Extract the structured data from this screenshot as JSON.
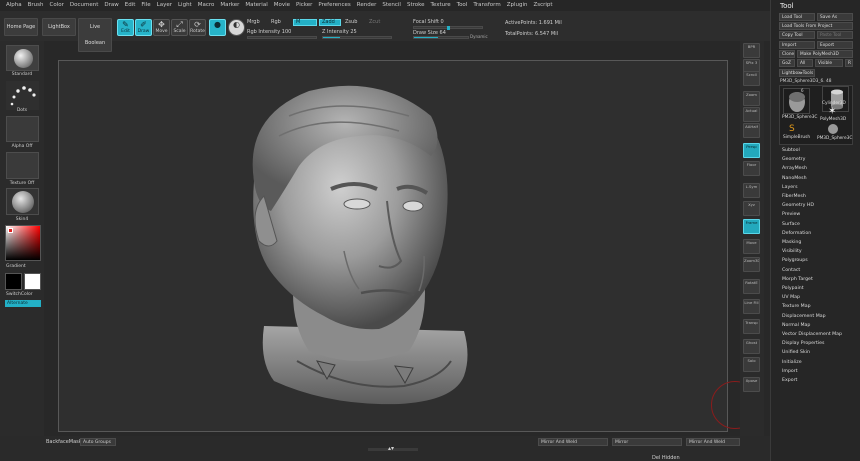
{
  "menu": [
    "Alpha",
    "Brush",
    "Color",
    "Document",
    "Draw",
    "Edit",
    "File",
    "Layer",
    "Light",
    "Macro",
    "Marker",
    "Material",
    "Movie",
    "Picker",
    "Preferences",
    "Render",
    "Stencil",
    "Stroke",
    "Texture",
    "Tool",
    "Transform",
    "Zplugin",
    "Zscript"
  ],
  "topbar": {
    "home_page": "Home Page",
    "lightbox": "LightBox",
    "live_boolean": "Live Boolean",
    "edit": "Edit",
    "draw": "Draw",
    "move": "Move",
    "scale": "Scale",
    "rotate": "Rotate",
    "mrgb": "Mrgb",
    "rgb": "Rgb",
    "m": "M",
    "zadd": "Zadd",
    "zsub": "Zsub",
    "zcut": "Zcut",
    "rgb_intensity_label": "Rgb Intensity",
    "rgb_intensity_value": "100",
    "z_intensity_label": "Z Intensity",
    "z_intensity_value": "25",
    "focal_shift_label": "Focal Shift",
    "focal_shift_value": "0",
    "draw_size_label": "Draw Size",
    "draw_size_value": "64",
    "dynamic": "Dynamic",
    "active_points": "ActivePoints: 1.691 Mil",
    "total_points": "TotalPoints: 6.547 Mil"
  },
  "left": {
    "standard": "Standard",
    "dots": "Dots",
    "alpha_off": "Alpha Off",
    "texture_off": "Texture Off",
    "skin": "Skin4",
    "gradient": "Gradient",
    "switch_color": "SwitchColor",
    "alternate": "Alternate"
  },
  "bottom": {
    "backface_mask": "BackfaceMask",
    "auto_groups": "Auto Groups",
    "mirror_and_weld_1": "Mirror And Weld",
    "mirror": "Mirror",
    "mirror_and_weld_2": "Mirror And Weld",
    "del_hidden": "Del Hidden"
  },
  "shelf": [
    "BPR",
    "SPix 3",
    "Scroll",
    "Zoom",
    "Actual",
    "AAHalf",
    "Persp",
    "Floor",
    "L.Sym",
    "Xyz",
    "Frame",
    "Move",
    "Zoom3D",
    "RotatE",
    "Line Fill",
    "Transp",
    "Ghost",
    "Solo",
    "Xpose"
  ],
  "shelf_values": {
    "spix": "SPix 3"
  },
  "tool": {
    "title": "Tool",
    "load_tool": "Load Tool",
    "save_as": "Save As",
    "load_from_project": "Load Tools From Project",
    "copy_tool": "Copy Tool",
    "paste_tool": "Paste Tool",
    "import": "Import",
    "export": "Export",
    "clone": "Clone",
    "make_polymesh": "Make PolyMesh3D",
    "goz": "GoZ",
    "all": "All",
    "visible": "Visible",
    "r": "R",
    "lightbox_tools": "Lightbox▸Tools",
    "current_tool": "PM3D_Sphere3D3_6.",
    "current_count": "48",
    "thumbs": [
      "PM3D_Sphere3C",
      "Cylinder3D",
      "PolyMesh3D",
      "SimpleBrush",
      "PM3D_Sphere3C"
    ],
    "thumb_counts": [
      "6",
      "",
      "",
      "",
      ""
    ],
    "subpalettes": [
      "Subtool",
      "Geometry",
      "ArrayMesh",
      "NanoMesh",
      "Layers",
      "FiberMesh",
      "Geometry HD",
      "Preview",
      "Surface",
      "Deformation",
      "Masking",
      "Visibility",
      "Polygroups",
      "Contact",
      "Morph Target",
      "Polypaint",
      "UV Map",
      "Texture Map",
      "Displacement Map",
      "Normal Map",
      "Vector Displacement Map",
      "Display Properties",
      "Unified Skin",
      "Initialize",
      "Import",
      "Export"
    ]
  },
  "colors": {
    "accent": "#23b0c6",
    "panel": "#2b2b2b",
    "viewport": "#2f2f2f",
    "brush_ring": "#8a1c1c"
  }
}
